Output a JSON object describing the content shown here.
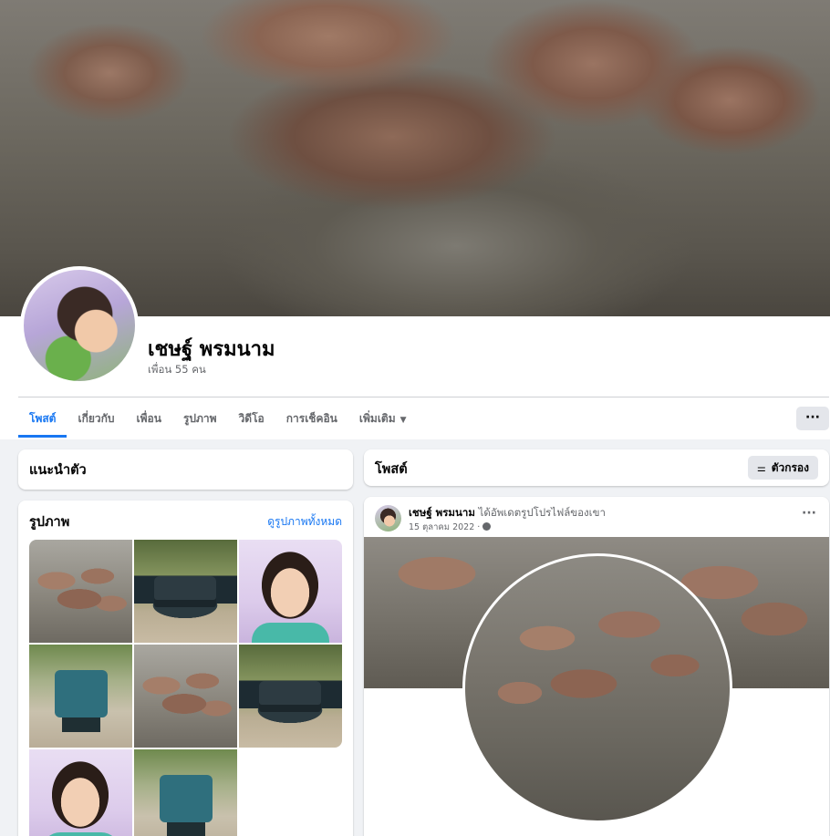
{
  "profile": {
    "name": "เชษฐ์ พรมนาม",
    "friends": "เพื่อน 55 คน"
  },
  "tabs": [
    {
      "label": "โพสต์",
      "active": true
    },
    {
      "label": "เกี่ยวกับ"
    },
    {
      "label": "เพื่อน"
    },
    {
      "label": "รูปภาพ"
    },
    {
      "label": "วิดีโอ"
    },
    {
      "label": "การเช็คอิน"
    },
    {
      "label": "เพิ่มเติม"
    }
  ],
  "more_button": "···",
  "intro": {
    "title": "แนะนำตัว"
  },
  "photos": {
    "title": "รูปภาพ",
    "see_all": "ดูรูปภาพทั้งหมด",
    "items": [
      "mushrooms",
      "pickup-truck",
      "girl-portrait",
      "tractor",
      "mushrooms",
      "pickup-truck",
      "girl-portrait",
      "tractor"
    ]
  },
  "posts": {
    "title": "โพสต์",
    "filter_label": "ตัวกรอง",
    "filter_icon": "sliders-icon"
  },
  "post": {
    "author": "เชษฐ์ พรมนาม",
    "action": "ได้อัพเดตรูปโปรไฟล์ของเขา",
    "date": "15 ตุลาคม 2022 ·",
    "privacy_icon": "globe-icon",
    "more": "···"
  },
  "colors": {
    "accent": "#1877f2",
    "background": "#f0f2f5",
    "card": "#ffffff",
    "secondary_text": "#65676b"
  }
}
